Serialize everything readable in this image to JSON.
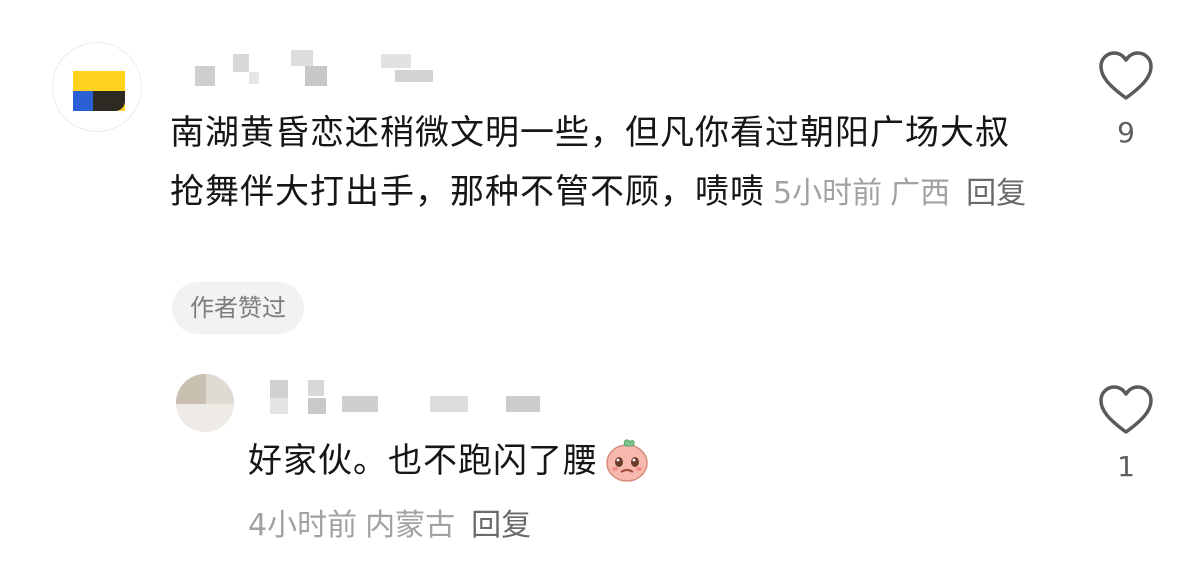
{
  "comments": [
    {
      "text": "南湖黄昏恋还稍微文明一些，但凡你看过朝阳广场大叔抢舞伴大打出手，那种不管不顾，啧啧",
      "time": "5小时前",
      "location": "广西",
      "reply_label": "回复",
      "badge": "作者赞过",
      "like_count": "9"
    },
    {
      "text": "好家伙。也不跑闪了腰",
      "emoji": "crying-peach-emoji",
      "time": "4小时前",
      "location": "内蒙古",
      "reply_label": "回复",
      "like_count": "1"
    }
  ],
  "icons": {
    "like": "heart-outline-icon"
  }
}
